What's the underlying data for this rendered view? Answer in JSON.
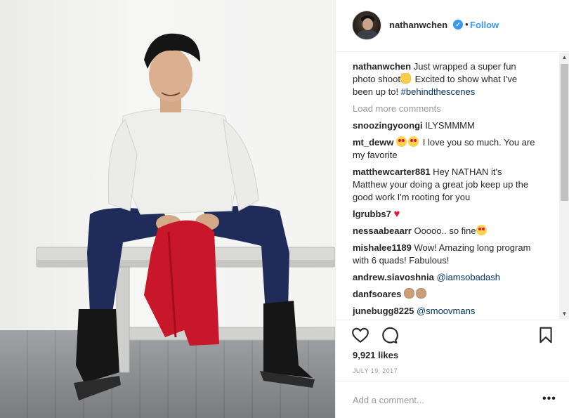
{
  "post": {
    "image_alt": "Young man in white long-sleeve shirt and navy pants sitting on a bench wearing black ice skates, holding a red jacket",
    "username": "nathanwchen",
    "verified_label": "✓",
    "dot": "•",
    "follow_label": "Follow"
  },
  "caption": {
    "user": "nathanwchen",
    "text_1": " Just wrapped a super fun photo shoot",
    "text_2": " Excited to show what I've been up to! ",
    "hashtag": "#behindthescenes"
  },
  "load_more": "Load more comments",
  "comments": [
    {
      "user": "snoozingyoongi",
      "text": " ILYSMMMM"
    },
    {
      "user": "mt_deww",
      "text": " I love you so much. You are my favorite"
    },
    {
      "user": "matthewcarter881",
      "text": " Hey NATHAN it's Matthew your doing a great job keep up the good work I'm rooting for you"
    },
    {
      "user": "lgrubbs7",
      "text": " "
    },
    {
      "user": "nessaabeaarr",
      "text": " Ooooo.. so fine"
    },
    {
      "user": "mishalee1189",
      "text": " Wow! Amazing long program with 6 quads! Fabulous!"
    },
    {
      "user": "andrew.siavoshnia",
      "text": " ",
      "mention": "@iamsobadash"
    },
    {
      "user": "danfsoares",
      "text": " "
    },
    {
      "user": "junebugg8225",
      "text": " ",
      "mention": "@smoovmans"
    }
  ],
  "icons": {
    "like": "heart-outline-icon",
    "comment": "comment-bubble-icon",
    "save": "bookmark-icon",
    "scroll_up": "▲",
    "scroll_down": "▼"
  },
  "likes": "9,921 likes",
  "date": "JULY 19, 2017",
  "add_comment_placeholder": "Add a comment...",
  "more_label": "•••",
  "colors": {
    "link": "#3897f0",
    "hashtag": "#003569",
    "muted": "#999999",
    "text": "#262626"
  }
}
